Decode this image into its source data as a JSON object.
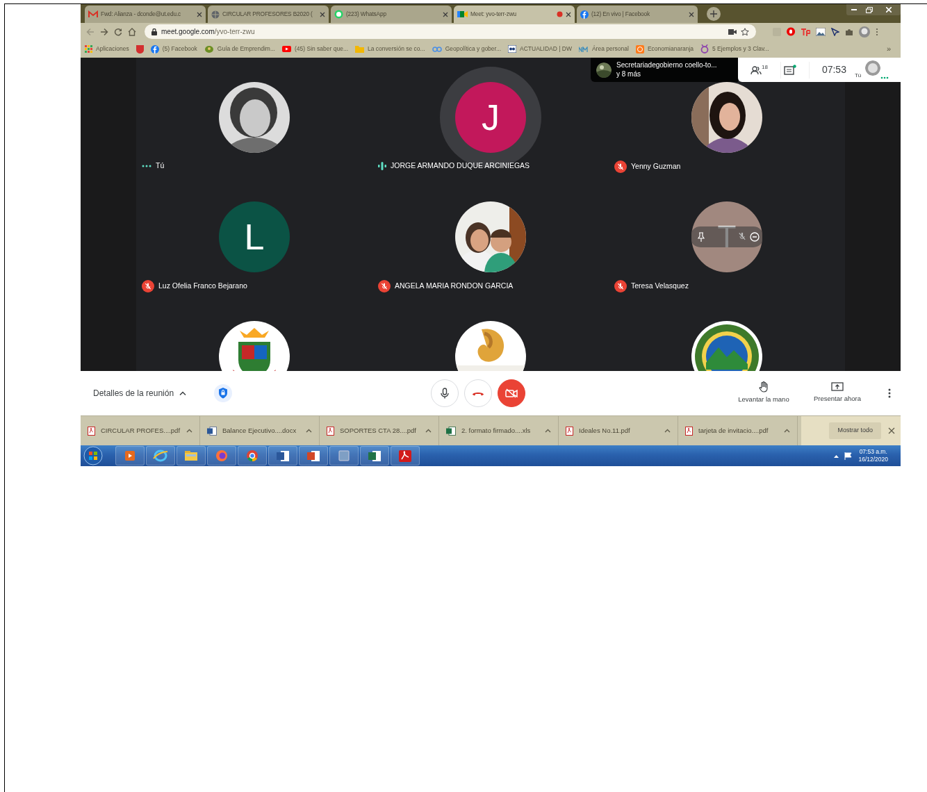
{
  "browser": {
    "tabs": [
      {
        "title": "Fwd: Alianza - dconde@ut.edu.c",
        "kind": "gmail",
        "selected": false,
        "recording": false
      },
      {
        "title": "CIRCULAR PROFESORES B2020 (",
        "kind": "globe",
        "selected": false,
        "recording": false
      },
      {
        "title": "(223) WhatsApp",
        "kind": "whatsapp",
        "selected": false,
        "recording": false
      },
      {
        "title": "Meet: yvo-terr-zwu",
        "kind": "meet",
        "selected": true,
        "recording": true
      },
      {
        "title": "(12) En vivo | Facebook",
        "kind": "facebook",
        "selected": false,
        "recording": false
      }
    ],
    "address_host": "meet.google.com",
    "address_path": "/yvo-terr-zwu",
    "bookmarks": [
      {
        "label": "Aplicaciones",
        "kind": "apps"
      },
      {
        "kind": "ut"
      },
      {
        "label": "(5) Facebook",
        "kind": "facebook"
      },
      {
        "label": "Guía de Emprendim...",
        "kind": "leaf"
      },
      {
        "label": "(45) Sin saber que...",
        "kind": "youtube"
      },
      {
        "label": "La conversión se co...",
        "kind": "folder"
      },
      {
        "label": "Geopolítica y gober...",
        "kind": "link"
      },
      {
        "label": "ACTUALIDAD | DW",
        "kind": "dw"
      },
      {
        "label": "Área personal",
        "kind": "nm"
      },
      {
        "label": "Economianaranja",
        "kind": "orange"
      },
      {
        "label": "5 Ejemplos y 3 Clav...",
        "kind": "ring"
      }
    ],
    "bookmarks_overflow": "»"
  },
  "meet": {
    "presenting": {
      "name": "Secretariadegobierno coello-to...",
      "more": "y 8 más"
    },
    "participants_count": "18",
    "chat_unread": true,
    "clock": "07:53",
    "self_label": "Tú",
    "tiles": [
      {
        "name": "Tú",
        "muted": false,
        "speaking": false,
        "more_menu": true
      },
      {
        "name": "JORGE ARMANDO DUQUE ARCINIEGAS",
        "kind": "initial",
        "initial": "J",
        "color": "#c2185b",
        "muted": false,
        "speaking": true
      },
      {
        "name": "Yenny Guzman",
        "muted": true,
        "speaking": false
      },
      {
        "name": "Luz Ofelia Franco Bejarano",
        "kind": "initial",
        "initial": "L",
        "color": "#0b5345",
        "muted": true,
        "speaking": false
      },
      {
        "name": "ANGELA MARIA RONDON GARCIA",
        "muted": true,
        "speaking": false
      },
      {
        "name": "Teresa Velasquez",
        "kind": "initial",
        "initial": "T",
        "color": "#a1887f",
        "muted": true,
        "speaking": false,
        "hovered": true
      },
      {
        "kind": "logo"
      },
      {
        "kind": "logo"
      },
      {
        "kind": "logo"
      }
    ],
    "details": "Detalles de la reunión",
    "mic_off": false,
    "camera_off": true,
    "actions": [
      {
        "label": "Levantar la mano",
        "kind": "hand"
      },
      {
        "label": "Presentar ahora",
        "kind": "present"
      }
    ]
  },
  "downloads": {
    "items": [
      {
        "name": "CIRCULAR PROFES....pdf",
        "kind": "pdf"
      },
      {
        "name": "Balance Ejecutivo....docx",
        "kind": "word"
      },
      {
        "name": "SOPORTES CTA 28....pdf",
        "kind": "pdf"
      },
      {
        "name": "2. formato firmado....xls",
        "kind": "excel"
      },
      {
        "name": "Ideales No.11.pdf",
        "kind": "pdf"
      },
      {
        "name": "tarjeta de invitacio....pdf",
        "kind": "pdf"
      }
    ],
    "show_all": "Mostrar todo"
  },
  "taskbar": {
    "apps": [
      {
        "kind": "media"
      },
      {
        "kind": "ie"
      },
      {
        "kind": "explorer"
      },
      {
        "kind": "firefox"
      },
      {
        "kind": "chrome"
      },
      {
        "kind": "word"
      },
      {
        "kind": "powerpoint"
      },
      {
        "kind": "blank"
      },
      {
        "kind": "excel"
      },
      {
        "kind": "acrobat"
      }
    ],
    "time": "07:53 a.m.",
    "date": "16/12/2020"
  }
}
